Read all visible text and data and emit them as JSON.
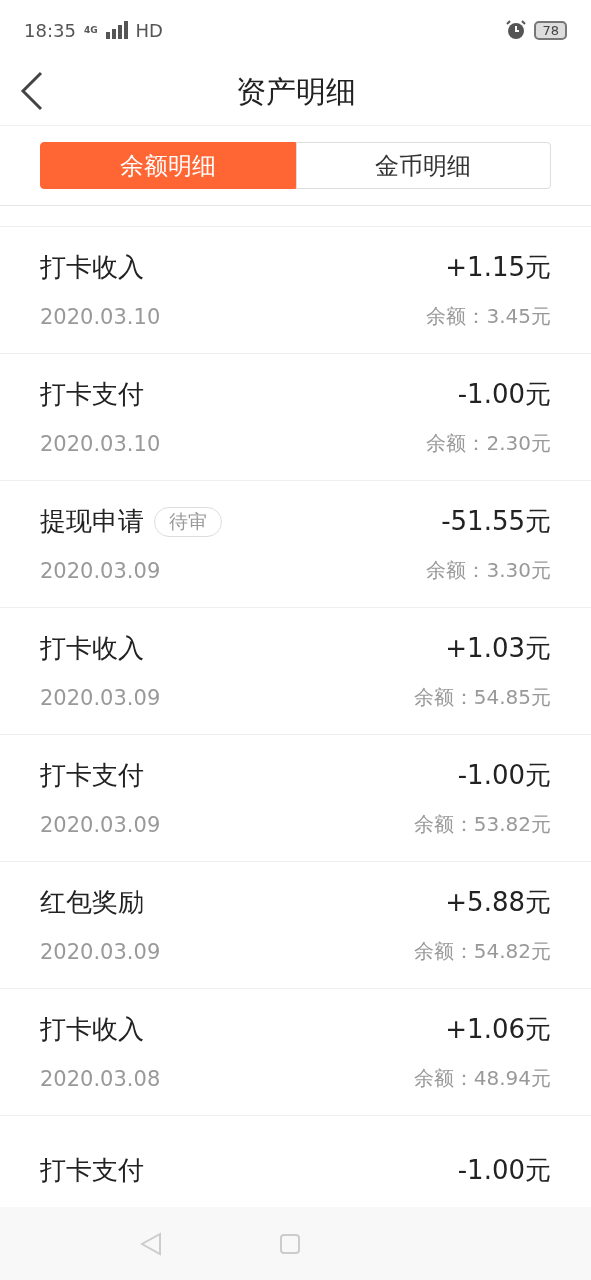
{
  "status_bar": {
    "time": "18:35",
    "network": "4G",
    "hd": "HD",
    "battery": "78"
  },
  "header": {
    "title": "资产明细"
  },
  "tabs": [
    {
      "label": "余额明细",
      "selected": true
    },
    {
      "label": "金币明细",
      "selected": false
    }
  ],
  "records": [
    {
      "title": "打卡收入",
      "amount": "+1.15元",
      "date": "2020.03.10",
      "balance": "余额：3.45元"
    },
    {
      "title": "打卡支付",
      "amount": "-1.00元",
      "date": "2020.03.10",
      "balance": "余额：2.30元"
    },
    {
      "title": "提现申请",
      "badge": "待审",
      "amount": "-51.55元",
      "date": "2020.03.09",
      "balance": "余额：3.30元"
    },
    {
      "title": "打卡收入",
      "amount": "+1.03元",
      "date": "2020.03.09",
      "balance": "余额：54.85元"
    },
    {
      "title": "打卡支付",
      "amount": "-1.00元",
      "date": "2020.03.09",
      "balance": "余额：53.82元"
    },
    {
      "title": "红包奖励",
      "amount": "+5.88元",
      "date": "2020.03.09",
      "balance": "余额：54.82元"
    },
    {
      "title": "打卡收入",
      "amount": "+1.06元",
      "date": "2020.03.08",
      "balance": "余额：48.94元"
    },
    {
      "title": "打卡支付",
      "amount": "-1.00元"
    }
  ]
}
